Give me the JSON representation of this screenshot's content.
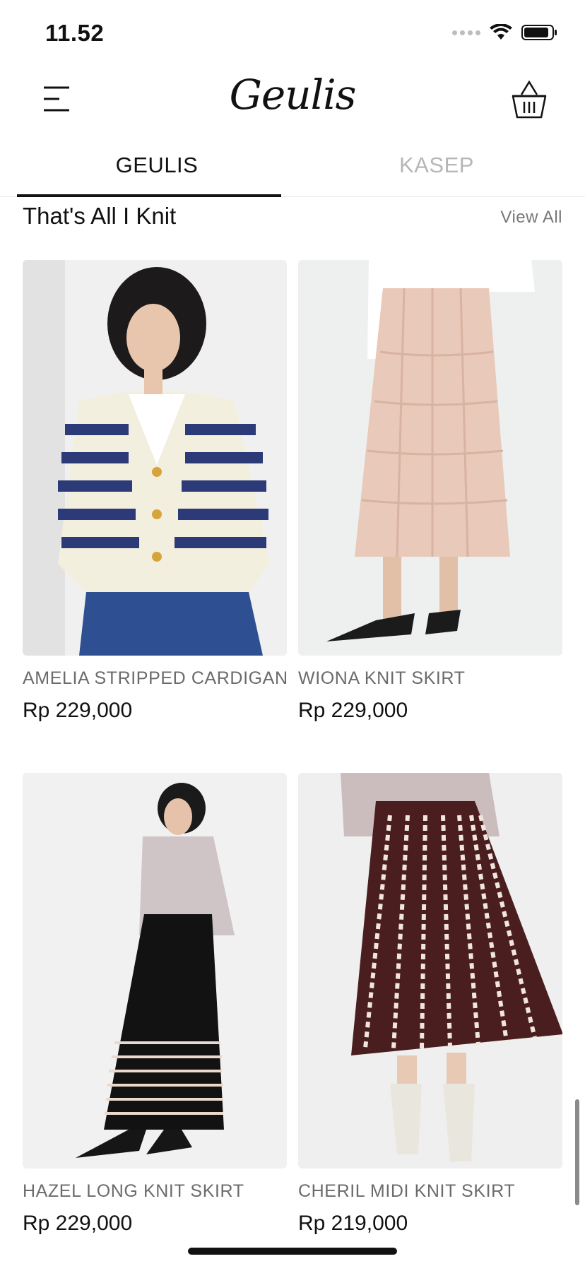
{
  "status_bar": {
    "time": "11.52"
  },
  "header": {
    "logo": "Geulis"
  },
  "tabs": [
    {
      "label": "GEULIS",
      "active": true
    },
    {
      "label": "KASEP",
      "active": false
    }
  ],
  "section": {
    "title": "That's All I Knit",
    "view_all": "View All"
  },
  "products": [
    {
      "name": "AMELIA STRIPPED CARDIGAN",
      "price": "Rp 229,000"
    },
    {
      "name": "WIONA KNIT SKIRT",
      "price": "Rp 229,000"
    },
    {
      "name": "HAZEL LONG KNIT SKIRT",
      "price": "Rp 229,000"
    },
    {
      "name": "CHERIL MIDI KNIT SKIRT",
      "price": "Rp 219,000"
    }
  ],
  "colors": {
    "text": "#111111",
    "muted": "#b6b6b6",
    "product_name": "#6b6b6b",
    "image_bg": "#eeeeee"
  },
  "icons": {
    "menu": "menu-icon",
    "cart": "basket-icon",
    "wifi": "wifi-icon",
    "battery": "battery-icon",
    "signal": "signal-icon"
  }
}
